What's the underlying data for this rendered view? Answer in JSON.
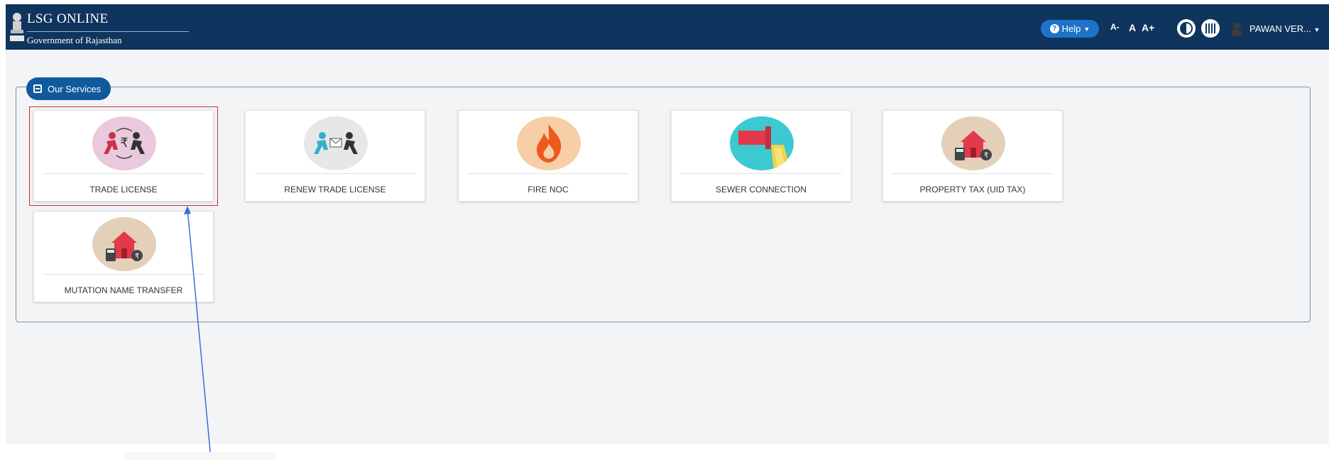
{
  "header": {
    "title": "LSG ONLINE",
    "subtitle": "Government of Rajasthan",
    "help_label": "Help",
    "font_decrease": "A-",
    "font_normal": "A",
    "font_increase": "A+",
    "user_name": "PAWAN VER...",
    "icons": [
      "emblem-icon",
      "help-icon",
      "contrast-icon",
      "qr-icon",
      "user-icon",
      "caret-down-icon"
    ]
  },
  "services": {
    "legend": "Our Services",
    "cards": [
      {
        "label": "TRADE LICENSE",
        "icon": "trade-license-icon",
        "bg": "#ebc9dd"
      },
      {
        "label": "RENEW TRADE LICENSE",
        "icon": "renew-license-icon",
        "bg": "#e7e7e9"
      },
      {
        "label": "FIRE NOC",
        "icon": "fire-icon",
        "bg": "#f6cfa6"
      },
      {
        "label": "SEWER CONNECTION",
        "icon": "sewer-pipe-icon",
        "bg": "#3cc9d1"
      },
      {
        "label": "PROPERTY TAX (UID TAX)",
        "icon": "property-tax-icon",
        "bg": "#e4d0b9"
      },
      {
        "label": "MUTATION NAME TRANSFER",
        "icon": "mutation-house-icon",
        "bg": "#e4d0b9"
      }
    ]
  },
  "colors": {
    "header_bg": "#0f355e",
    "accent": "#0f5a9c",
    "highlight_border": "#cc2e2e",
    "annotation_arrow": "#3c6fd8"
  }
}
